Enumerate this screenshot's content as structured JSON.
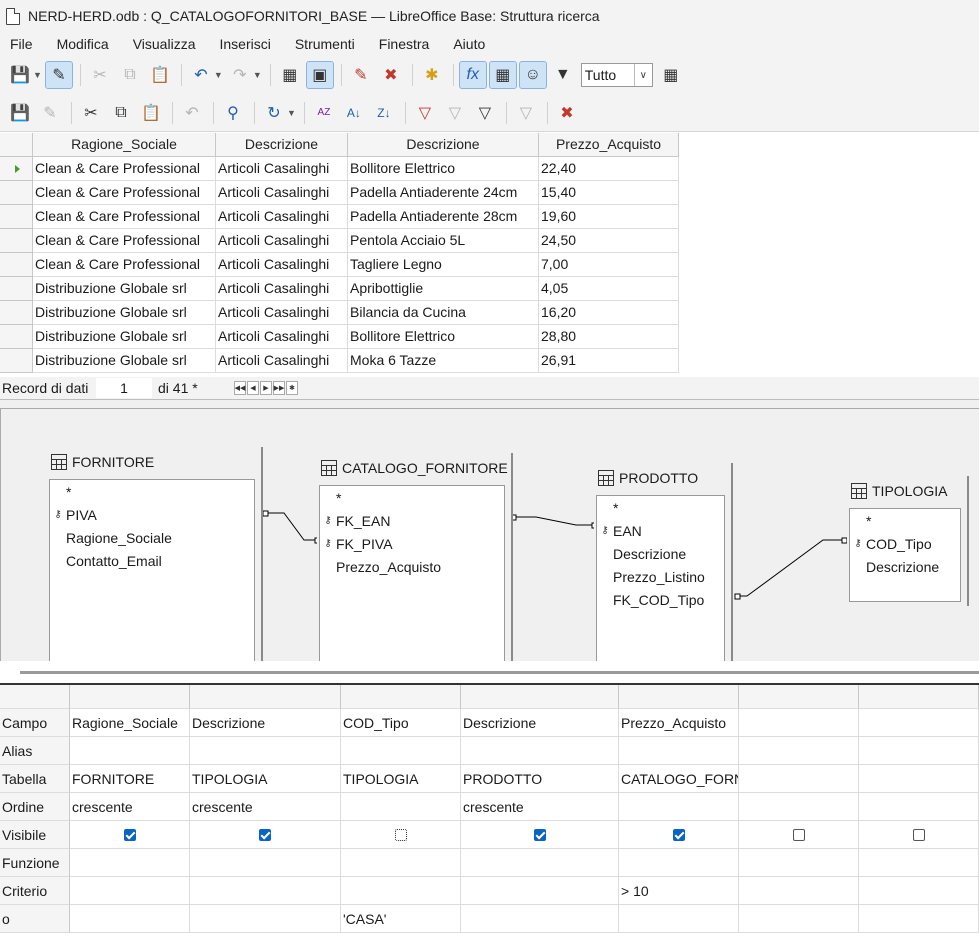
{
  "window": {
    "title": "NERD-HERD.odb : Q_CATALOGOFORNITORI_BASE — LibreOffice Base: Struttura ricerca"
  },
  "menu": [
    "File",
    "Modifica",
    "Visualizza",
    "Inserisci",
    "Strumenti",
    "Finestra",
    "Aiuto"
  ],
  "toolbar": {
    "limit_value": "Tutto"
  },
  "results": {
    "columns": [
      "Ragione_Sociale",
      "Descrizione",
      "Descrizione",
      "Prezzo_Acquisto"
    ],
    "rows": [
      [
        "Clean & Care Professional",
        "Articoli Casalinghi",
        "Bollitore Elettrico",
        "22,40"
      ],
      [
        "Clean & Care Professional",
        "Articoli Casalinghi",
        "Padella Antiaderente 24cm",
        "15,40"
      ],
      [
        "Clean & Care Professional",
        "Articoli Casalinghi",
        "Padella Antiaderente 28cm",
        "19,60"
      ],
      [
        "Clean & Care Professional",
        "Articoli Casalinghi",
        "Pentola Acciaio 5L",
        "24,50"
      ],
      [
        "Clean & Care Professional",
        "Articoli Casalinghi",
        "Tagliere Legno",
        "7,00"
      ],
      [
        "Distribuzione Globale srl",
        "Articoli Casalinghi",
        "Apribottiglie",
        "4,05"
      ],
      [
        "Distribuzione Globale srl",
        "Articoli Casalinghi",
        "Bilancia da Cucina",
        "16,20"
      ],
      [
        "Distribuzione Globale srl",
        "Articoli Casalinghi",
        "Bollitore Elettrico",
        "28,80"
      ],
      [
        "Distribuzione Globale srl",
        "Articoli Casalinghi",
        "Moka 6 Tazze",
        "26,91"
      ]
    ]
  },
  "navigation": {
    "label": "Record di dati",
    "current": "1",
    "total": "di 41 *"
  },
  "design": {
    "tables": [
      {
        "name": "FORNITORE",
        "fields": [
          {
            "name": "*",
            "key": false
          },
          {
            "name": "PIVA",
            "key": true
          },
          {
            "name": "Ragione_Sociale",
            "key": false
          },
          {
            "name": "Contatto_Email",
            "key": false
          }
        ]
      },
      {
        "name": "CATALOGO_FORNITORE",
        "fields": [
          {
            "name": "*",
            "key": false
          },
          {
            "name": "FK_EAN",
            "key": true
          },
          {
            "name": "FK_PIVA",
            "key": true
          },
          {
            "name": "Prezzo_Acquisto",
            "key": false
          }
        ]
      },
      {
        "name": "PRODOTTO",
        "fields": [
          {
            "name": "*",
            "key": false
          },
          {
            "name": "EAN",
            "key": true
          },
          {
            "name": "Descrizione",
            "key": false
          },
          {
            "name": "Prezzo_Listino",
            "key": false
          },
          {
            "name": "FK_COD_Tipo",
            "key": false
          }
        ]
      },
      {
        "name": "TIPOLOGIA",
        "fields": [
          {
            "name": "*",
            "key": false
          },
          {
            "name": "COD_Tipo",
            "key": true
          },
          {
            "name": "Descrizione",
            "key": false
          }
        ]
      }
    ]
  },
  "criteria": {
    "row_labels": [
      "Campo",
      "Alias",
      "Tabella",
      "Ordine",
      "Visibile",
      "Funzione",
      "Criterio",
      "o"
    ],
    "columns": [
      {
        "campo": "Ragione_Sociale",
        "tabella": "FORNITORE",
        "ordine": "crescente",
        "visibile": true,
        "criterio": "",
        "o": ""
      },
      {
        "campo": "Descrizione",
        "tabella": "TIPOLOGIA",
        "ordine": "crescente",
        "visibile": true,
        "criterio": "",
        "o": ""
      },
      {
        "campo": "COD_Tipo",
        "tabella": "TIPOLOGIA",
        "ordine": "",
        "visibile": false,
        "criterio": "",
        "o": "'CASA'"
      },
      {
        "campo": "Descrizione",
        "tabella": "PRODOTTO",
        "ordine": "crescente",
        "visibile": true,
        "criterio": "",
        "o": ""
      },
      {
        "campo": "Prezzo_Acquisto",
        "tabella": "CATALOGO_FORN",
        "ordine": "",
        "visibile": true,
        "criterio": "> 10",
        "o": ""
      },
      {
        "campo": "",
        "tabella": "",
        "ordine": "",
        "visibile": false,
        "criterio": "",
        "o": ""
      },
      {
        "campo": "",
        "tabella": "",
        "ordine": "",
        "visibile": false,
        "criterio": "",
        "o": ""
      }
    ]
  }
}
